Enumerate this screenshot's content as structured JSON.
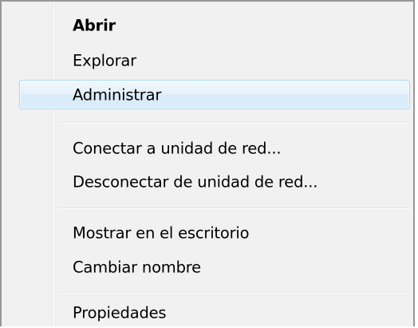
{
  "context_menu": {
    "items": [
      {
        "label": "Abrir"
      },
      {
        "label": "Explorar"
      },
      {
        "label": "Administrar"
      },
      {
        "label": "Conectar a unidad de red..."
      },
      {
        "label": "Desconectar de unidad de red..."
      },
      {
        "label": "Mostrar en el escritorio"
      },
      {
        "label": "Cambiar nombre"
      },
      {
        "label": "Propiedades"
      }
    ],
    "default_item": "Abrir",
    "highlighted_item": "Administrar"
  }
}
